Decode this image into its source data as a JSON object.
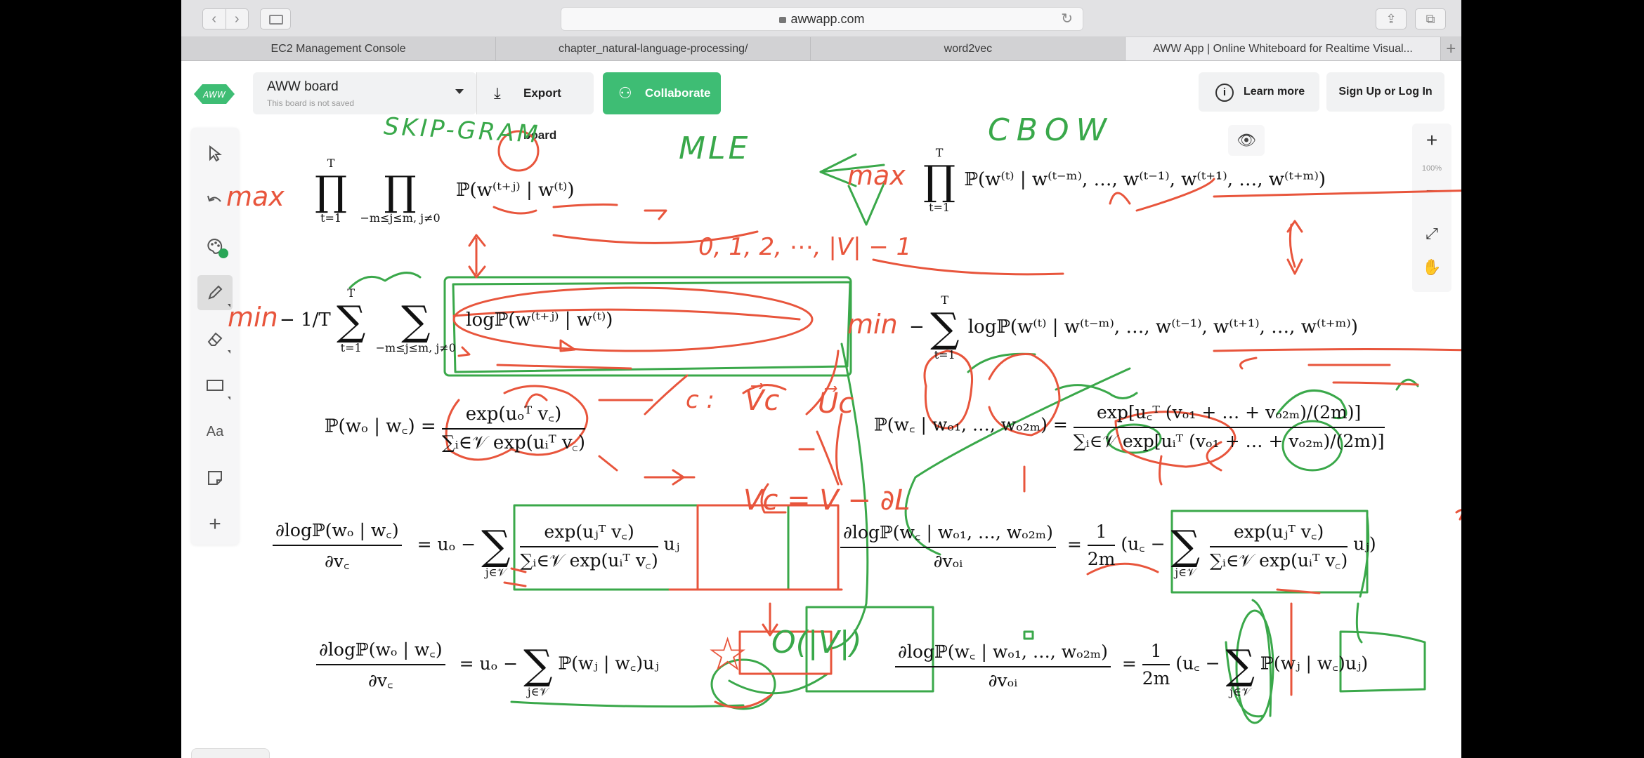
{
  "browser": {
    "url": "awwapp.com",
    "tabs": [
      {
        "label": "EC2 Management Console",
        "active": false
      },
      {
        "label": "chapter_natural-language-processing/",
        "active": false
      },
      {
        "label": "word2vec",
        "active": false
      },
      {
        "label": "AWW App | Online Whiteboard for Realtime Visual...",
        "active": true
      }
    ]
  },
  "header": {
    "logo_text": "AWW",
    "board_name": "AWW board",
    "board_status": "This board is not saved",
    "export_label": "Export board",
    "collaborate_label": "Collaborate",
    "learn_more_label": "Learn more",
    "sign_up_label": "Sign Up or Log In"
  },
  "tools": {
    "text_tool_label": "Aa",
    "palette_color": "#2aa657"
  },
  "zoom": {
    "zoom_in": "+",
    "level": "100%",
    "zoom_out": "−"
  },
  "handwriting": {
    "skipgram": "SKIP-GRAM",
    "mle": "MLE",
    "cbow": "CBOW",
    "max_left": "max",
    "max_right": "max",
    "min_left": "min",
    "min_right": "min",
    "vocab_range": "0, 1, 2, ⋯, |V| − 1",
    "c_label": "c :",
    "vc": "V⃗c",
    "uc": "U⃗c",
    "update": "Vc = V − ∂L",
    "complexity": "O(|V|)",
    "star": "☆"
  },
  "formulas": {
    "sg_max_term": "ℙ(w⁽ᵗ⁺ʲ⁾ | w⁽ᵗ⁾)",
    "sg_prod1_sup": "T",
    "sg_prod1_sub": "t=1",
    "sg_prod2_sub": "−m≤j≤m, j≠0",
    "cbow_max_term": "ℙ(w⁽ᵗ⁾ | w⁽ᵗ⁻ᵐ⁾, …, w⁽ᵗ⁻¹⁾, w⁽ᵗ⁺¹⁾, …, w⁽ᵗ⁺ᵐ⁾)",
    "sg_min_prefix": "− 1/T",
    "sg_min_term": "logℙ(w⁽ᵗ⁺ʲ⁾ | w⁽ᵗ⁾)",
    "cbow_min_term": "logℙ(w⁽ᵗ⁾ | w⁽ᵗ⁻ᵐ⁾, …, w⁽ᵗ⁻¹⁾, w⁽ᵗ⁺¹⁾, …, w⁽ᵗ⁺ᵐ⁾)",
    "sg_prob_lhs": "ℙ(wₒ | w꜀) =",
    "sg_prob_num": "exp(uₒᵀ v꜀)",
    "sg_prob_den": "∑ᵢ∈𝒱 exp(uᵢᵀ v꜀)",
    "cbow_prob_lhs": "ℙ(w꜀ | wₒ₁, …, wₒ₂ₘ) =",
    "cbow_prob_num": "exp[u꜀ᵀ (vₒ₁ + … + vₒ₂ₘ)/(2m)]",
    "cbow_prob_den": "∑ᵢ∈𝒱 exp[uᵢᵀ (vₒ₁ + … + vₒ₂ₘ)/(2m)]",
    "sg_grad_num": "∂logℙ(wₒ | w꜀)",
    "sg_grad_den": "∂v꜀",
    "sg_grad_rhs_a": "= uₒ −",
    "sg_grad_sum_sub": "j∈𝒱",
    "sg_grad_inner_num": "exp(uⱼᵀ v꜀)",
    "sg_grad_inner_den": "∑ᵢ∈𝒱 exp(uᵢᵀ v꜀)",
    "sg_grad_tail": "uⱼ",
    "cbow_grad_num": "∂logℙ(w꜀ | wₒ₁, …, wₒ₂ₘ)",
    "cbow_grad_den": "∂vₒᵢ",
    "cbow_grad_coef_num": "1",
    "cbow_grad_coef_den": "2m",
    "cbow_grad_rhs_a": "(u꜀ −",
    "cbow_grad_inner_num": "exp(uⱼᵀ v꜀)",
    "cbow_grad_inner_den": "∑ᵢ∈𝒱 exp(uᵢᵀ v꜀)",
    "cbow_grad_tail": "uⱼ)",
    "sg_final_num": "∂logℙ(wₒ | w꜀)",
    "sg_final_den": "∂v꜀",
    "sg_final_rhs": "= uₒ −",
    "sg_final_term": "ℙ(wⱼ | w꜀)uⱼ",
    "cbow_final_num": "∂logℙ(w꜀ | wₒ₁, …, wₒ₂ₘ)",
    "cbow_final_den": "∂vₒᵢ",
    "cbow_final_term": "ℙ(wⱼ | w꜀)uⱼ)"
  }
}
